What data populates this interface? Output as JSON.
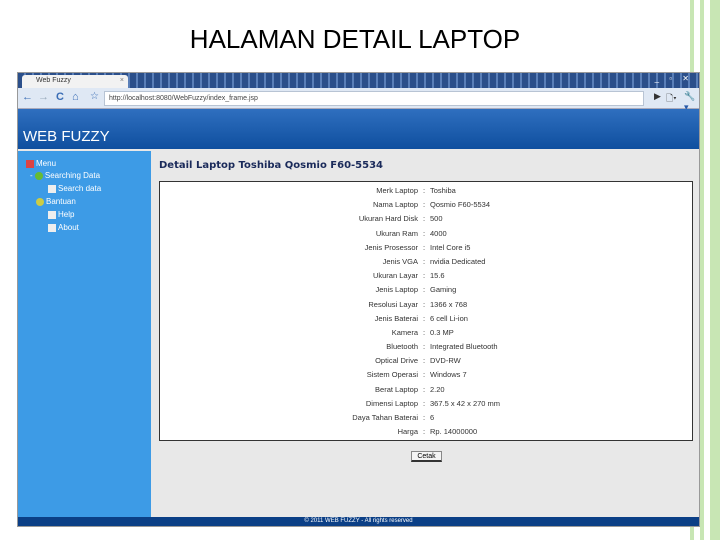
{
  "slide_title": "HALAMAN DETAIL LAPTOP",
  "browser": {
    "tab_title": "Web Fuzzy",
    "url": "http://localhost:8080/WebFuzzy/index_frame.jsp"
  },
  "app": {
    "logo": "WEB FUZZY",
    "footer": "© 2011 WEB FUZZY - All rights reserved"
  },
  "sidebar": {
    "items": [
      {
        "label": "Menu"
      },
      {
        "label": "Searching Data"
      },
      {
        "label": "Search data"
      },
      {
        "label": "Bantuan"
      },
      {
        "label": "Help"
      },
      {
        "label": "About"
      }
    ]
  },
  "detail": {
    "title": "Detail Laptop Toshiba Qosmio F60-5534",
    "rows": [
      {
        "label": "Merk Laptop",
        "value": "Toshiba"
      },
      {
        "label": "Nama Laptop",
        "value": "Qosmio F60-5534"
      },
      {
        "label": "Ukuran Hard Disk",
        "value": "500"
      },
      {
        "label": "Ukuran Ram",
        "value": "4000"
      },
      {
        "label": "Jenis Prosessor",
        "value": "Intel Core i5"
      },
      {
        "label": "Jenis VGA",
        "value": "nvidia Dedicated"
      },
      {
        "label": "Ukuran Layar",
        "value": "15.6"
      },
      {
        "label": "Jenis Laptop",
        "value": "Gaming"
      },
      {
        "label": "Resolusi Layar",
        "value": "1366 x 768"
      },
      {
        "label": "Jenis Baterai",
        "value": "6 cell Li-ion"
      },
      {
        "label": "Kamera",
        "value": "0.3 MP"
      },
      {
        "label": "Bluetooth",
        "value": "Integrated Bluetooth"
      },
      {
        "label": "Optical Drive",
        "value": "DVD-RW"
      },
      {
        "label": "Sistem Operasi",
        "value": "Windows 7"
      },
      {
        "label": "Berat Laptop",
        "value": "2.20"
      },
      {
        "label": "Dimensi Laptop",
        "value": "367.5 x 42 x 270 mm"
      },
      {
        "label": "Daya Tahan Baterai",
        "value": "6"
      },
      {
        "label": "Harga",
        "value": "Rp. 14000000"
      }
    ],
    "separator": ":",
    "print_button": "Cetak"
  }
}
